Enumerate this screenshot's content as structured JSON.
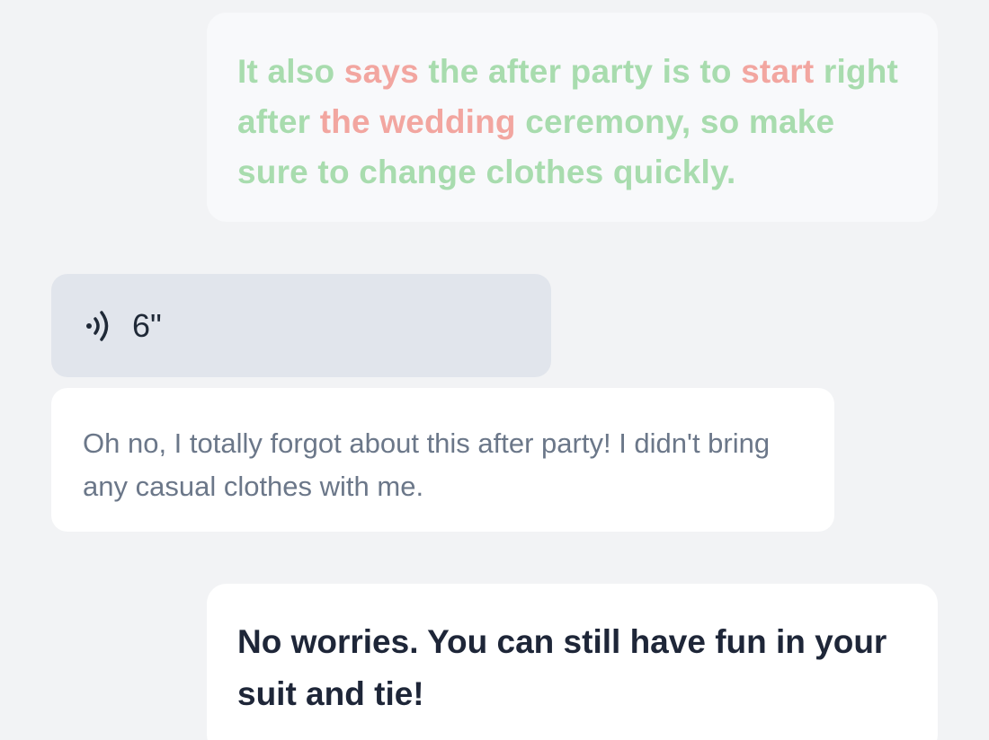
{
  "colors": {
    "background": "#f2f3f5",
    "correct_word": "#a8dcae",
    "incorrect_word": "#f2a6a0",
    "voice_bubble": "#e1e5ec",
    "transcript_text": "#6b7789",
    "reply_text": "#1e2638"
  },
  "messages": {
    "feedback": {
      "segments": [
        {
          "text": "It also ",
          "status": "correct"
        },
        {
          "text": "says",
          "status": "incorrect"
        },
        {
          "text": " the after party is to ",
          "status": "correct"
        },
        {
          "text": "start",
          "status": "incorrect"
        },
        {
          "text": " right after ",
          "status": "correct"
        },
        {
          "text": "the wedding",
          "status": "incorrect"
        },
        {
          "text": " ceremony, so make sure to change clothes quickly.",
          "status": "correct"
        }
      ]
    },
    "voice": {
      "icon": "sound-wave-icon",
      "duration": "6\""
    },
    "transcript": {
      "text": "Oh no, I totally forgot about this after party! I didn't bring any casual clothes with me."
    },
    "reply": {
      "text": "No worries. You can still have fun in your suit and tie!"
    }
  }
}
